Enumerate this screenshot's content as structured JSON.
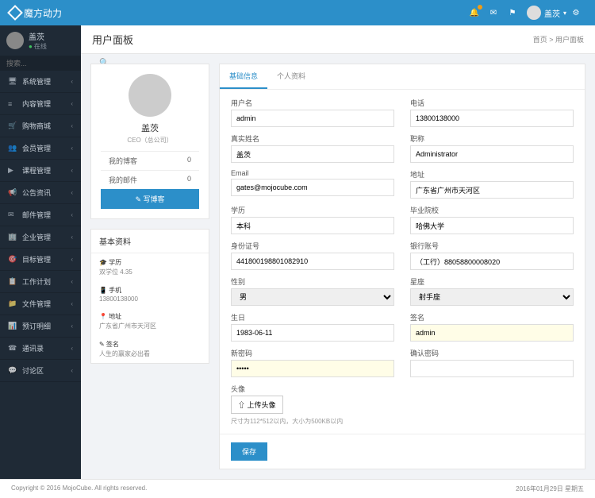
{
  "header": {
    "brand": "魔方动力",
    "userName": "盖茨"
  },
  "sidebar": {
    "userName": "盖茨",
    "status": "在线",
    "searchPlaceholder": "搜索...",
    "menu": [
      {
        "icon": "🖥",
        "label": "系统管理"
      },
      {
        "icon": "≡",
        "label": "内容管理"
      },
      {
        "icon": "🛒",
        "label": "购物商城"
      },
      {
        "icon": "👥",
        "label": "会员管理"
      },
      {
        "icon": "▶",
        "label": "课程管理"
      },
      {
        "icon": "📢",
        "label": "公告资讯"
      },
      {
        "icon": "✉",
        "label": "邮件管理"
      },
      {
        "icon": "🏢",
        "label": "企业管理"
      },
      {
        "icon": "🎯",
        "label": "目标管理"
      },
      {
        "icon": "📋",
        "label": "工作计划"
      },
      {
        "icon": "📁",
        "label": "文件管理"
      },
      {
        "icon": "📊",
        "label": "预订明细"
      },
      {
        "icon": "☎",
        "label": "通讯录"
      },
      {
        "icon": "💬",
        "label": "讨论区"
      }
    ]
  },
  "page": {
    "title": "用户面板",
    "breadcrumbHome": "首页",
    "breadcrumbCurrent": "用户面板"
  },
  "profile": {
    "name": "盖茨",
    "role": "CEO（总公司）",
    "stats": [
      {
        "label": "我的博客",
        "value": "0"
      },
      {
        "label": "我的邮件",
        "value": "0"
      }
    ],
    "writeBlog": "✎ 写博客"
  },
  "basicInfo": {
    "title": "基本资料",
    "items": [
      {
        "icon": "🎓",
        "label": "学历",
        "value": "双学位 4.35"
      },
      {
        "icon": "📱",
        "label": "手机",
        "value": "13800138000"
      },
      {
        "icon": "📍",
        "label": "地址",
        "value": "广东省广州市天河区"
      },
      {
        "icon": "✎",
        "label": "签名",
        "value": "人生的赢家必出看"
      }
    ]
  },
  "tabs": [
    {
      "label": "基础信息",
      "active": true
    },
    {
      "label": "个人资料",
      "active": false
    }
  ],
  "form": {
    "username": {
      "label": "用户名",
      "value": "admin"
    },
    "phone": {
      "label": "电话",
      "value": "13800138000"
    },
    "realname": {
      "label": "真实姓名",
      "value": "盖茨"
    },
    "position": {
      "label": "职称",
      "value": "Administrator"
    },
    "email": {
      "label": "Email",
      "value": "gates@mojocube.com"
    },
    "address": {
      "label": "地址",
      "value": "广东省广州市天河区"
    },
    "education": {
      "label": "学历",
      "value": "本科"
    },
    "school": {
      "label": "毕业院校",
      "value": "哈佛大学"
    },
    "idcard": {
      "label": "身份证号",
      "value": "441800198801082910"
    },
    "bankcard": {
      "label": "银行账号",
      "value": "（工行）88058800008020"
    },
    "gender": {
      "label": "性别",
      "value": "男"
    },
    "constellation": {
      "label": "星座",
      "value": "射手座"
    },
    "birthday": {
      "label": "生日",
      "value": "1983-06-11"
    },
    "signature": {
      "label": "签名",
      "value": "admin"
    },
    "newpwd": {
      "label": "新密码",
      "value": "•••••"
    },
    "confirmpwd": {
      "label": "确认密码",
      "value": ""
    },
    "avatar": {
      "label": "头像",
      "button": "⇧ 上传头像",
      "hint": "尺寸为112*512以内，大小为500KB以内"
    },
    "save": "保存"
  },
  "footer": {
    "copyright": "Copyright © 2016 MojoCube. All rights reserved.",
    "date": "2016年01月29日 星期五"
  }
}
